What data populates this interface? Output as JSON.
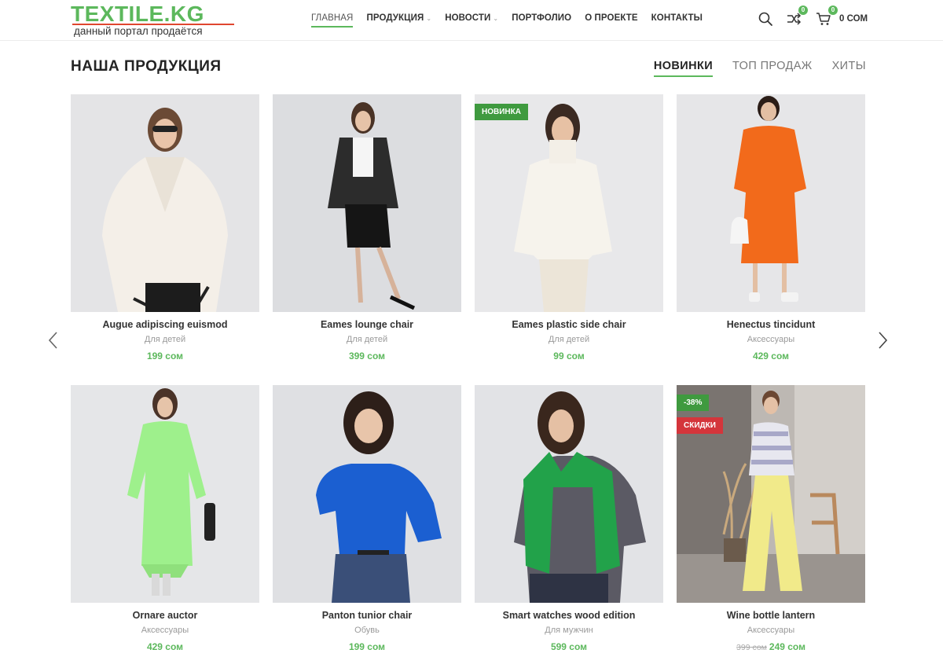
{
  "header": {
    "logo_text": "TEXTILE.KG",
    "logo_tagline": "данный портал продаётся",
    "nav": [
      {
        "label": "Главная",
        "active": true,
        "has_dropdown": false
      },
      {
        "label": "Продукция",
        "active": false,
        "has_dropdown": true
      },
      {
        "label": "Новости",
        "active": false,
        "has_dropdown": true
      },
      {
        "label": "Портфолио",
        "active": false,
        "has_dropdown": false
      },
      {
        "label": "О проекте",
        "active": false,
        "has_dropdown": false
      },
      {
        "label": "Контакты",
        "active": false,
        "has_dropdown": false
      }
    ],
    "compare_count": "0",
    "cart_count": "0",
    "cart_total": "0 СОМ",
    "icons": [
      "search-icon",
      "compare-icon",
      "cart-icon"
    ]
  },
  "section": {
    "title": "Наша продукция",
    "tabs": [
      {
        "label": "Новинки",
        "active": true
      },
      {
        "label": "Топ продаж",
        "active": false
      },
      {
        "label": "Хиты",
        "active": false
      }
    ]
  },
  "colors": {
    "accent": "#5cb85c",
    "sale_badge": "#d4353b",
    "new_badge": "#3f9a3f"
  },
  "products": [
    {
      "name": "Augue adipiscing euismod",
      "category": "Для детей",
      "price": "199 сом",
      "old_price": "",
      "badges": [],
      "image": "woman in white shearling jacket"
    },
    {
      "name": "Eames lounge chair",
      "category": "Для детей",
      "price": "399 сом",
      "old_price": "",
      "badges": [],
      "image": "woman in black blazer and skirt"
    },
    {
      "name": "Eames plastic side chair",
      "category": "Для детей",
      "price": "99 сом",
      "old_price": "",
      "badges": [
        "НОВИНКА"
      ],
      "image": "woman in cream sweater"
    },
    {
      "name": "Henectus tincidunt",
      "category": "Аксессуары",
      "price": "429 сом",
      "old_price": "",
      "badges": [],
      "image": "woman in orange knit dress"
    },
    {
      "name": "Ornare auctor",
      "category": "Аксессуары",
      "price": "429 сом",
      "old_price": "",
      "badges": [],
      "image": "woman in light green knit dress"
    },
    {
      "name": "Panton tunior chair",
      "category": "Обувь",
      "price": "199 сом",
      "old_price": "",
      "badges": [],
      "image": "woman in blue sweater"
    },
    {
      "name": "Smart watches wood edition",
      "category": "Для мужчин",
      "price": "599 сом",
      "old_price": "",
      "badges": [],
      "image": "woman in green puffer vest"
    },
    {
      "name": "Wine bottle lantern",
      "category": "Аксессуары",
      "price": "249 сом",
      "old_price": "399 сом",
      "badges": [
        "-38%",
        "СКИДКИ"
      ],
      "image": "woman in striped sweater and yellow trousers"
    }
  ]
}
